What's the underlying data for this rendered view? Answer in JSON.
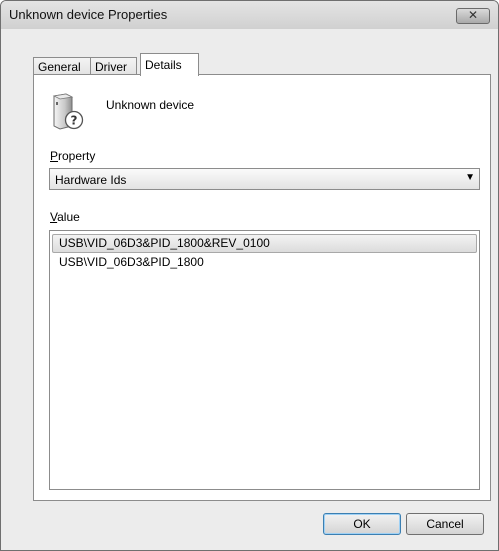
{
  "window": {
    "title": "Unknown device Properties"
  },
  "tabs": [
    {
      "label": "General"
    },
    {
      "label": "Driver"
    },
    {
      "label": "Details"
    }
  ],
  "device": {
    "name": "Unknown device",
    "icon": "unknown-device-icon"
  },
  "property": {
    "label_prefix": "",
    "label_accel": "P",
    "label_rest": "roperty",
    "selected": "Hardware Ids"
  },
  "value": {
    "label_accel": "V",
    "label_rest": "alue",
    "items": [
      {
        "text": "USB\\VID_06D3&PID_1800&REV_0100"
      },
      {
        "text": "USB\\VID_06D3&PID_1800"
      }
    ],
    "selected_index": 0
  },
  "buttons": {
    "ok": "OK",
    "cancel": "Cancel"
  },
  "close_glyph": "✕"
}
